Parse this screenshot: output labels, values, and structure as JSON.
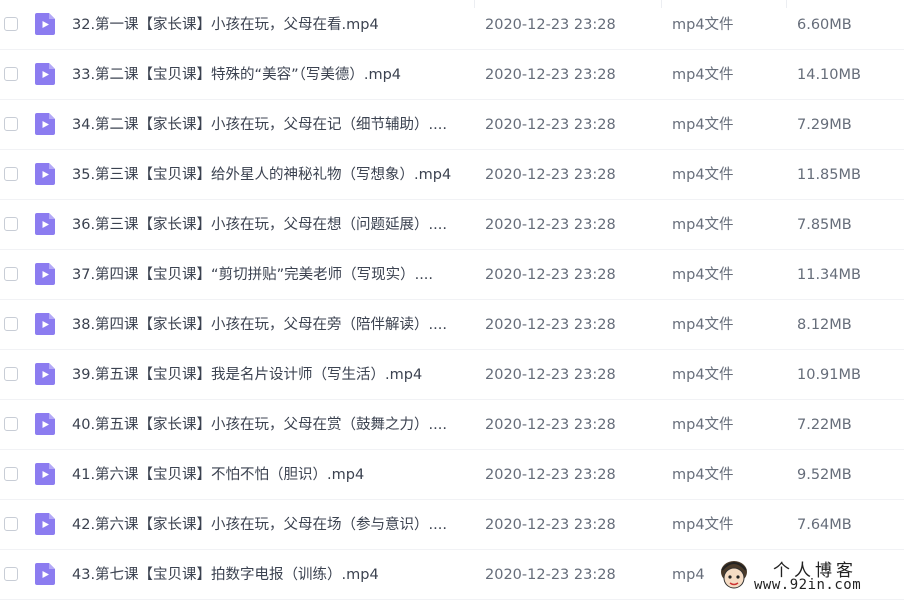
{
  "icon_color": "#8c7cf0",
  "files": [
    {
      "name": "32.第一课【家长课】小孩在玩，父母在看.mp4",
      "date": "2020-12-23 23:28",
      "type": "mp4文件",
      "size": "6.60MB"
    },
    {
      "name": "33.第二课【宝贝课】特殊的“美容”（写美德）.mp4",
      "date": "2020-12-23 23:28",
      "type": "mp4文件",
      "size": "14.10MB"
    },
    {
      "name": "34.第二课【家长课】小孩在玩，父母在记（细节辅助）....",
      "date": "2020-12-23 23:28",
      "type": "mp4文件",
      "size": "7.29MB"
    },
    {
      "name": "35.第三课【宝贝课】给外星人的神秘礼物（写想象）.mp4",
      "date": "2020-12-23 23:28",
      "type": "mp4文件",
      "size": "11.85MB"
    },
    {
      "name": "36.第三课【家长课】小孩在玩，父母在想（问题延展）....",
      "date": "2020-12-23 23:28",
      "type": "mp4文件",
      "size": "7.85MB"
    },
    {
      "name": "37.第四课【宝贝课】“剪切拼贴”完美老师（写现实）....",
      "date": "2020-12-23 23:28",
      "type": "mp4文件",
      "size": "11.34MB"
    },
    {
      "name": "38.第四课【家长课】小孩在玩，父母在旁（陪伴解读）....",
      "date": "2020-12-23 23:28",
      "type": "mp4文件",
      "size": "8.12MB"
    },
    {
      "name": "39.第五课【宝贝课】我是名片设计师（写生活）.mp4",
      "date": "2020-12-23 23:28",
      "type": "mp4文件",
      "size": "10.91MB"
    },
    {
      "name": "40.第五课【家长课】小孩在玩，父母在赏（鼓舞之力）....",
      "date": "2020-12-23 23:28",
      "type": "mp4文件",
      "size": "7.22MB"
    },
    {
      "name": "41.第六课【宝贝课】不怕不怕（胆识）.mp4",
      "date": "2020-12-23 23:28",
      "type": "mp4文件",
      "size": "9.52MB"
    },
    {
      "name": "42.第六课【家长课】小孩在玩，父母在场（参与意识）....",
      "date": "2020-12-23 23:28",
      "type": "mp4文件",
      "size": "7.64MB"
    },
    {
      "name": "43.第七课【宝贝课】拍数字电报（训练）.mp4",
      "date": "2020-12-23 23:28",
      "type": "mp4",
      "size": ""
    }
  ],
  "watermark": {
    "title": "个人博客",
    "url": "www.92in.com"
  }
}
